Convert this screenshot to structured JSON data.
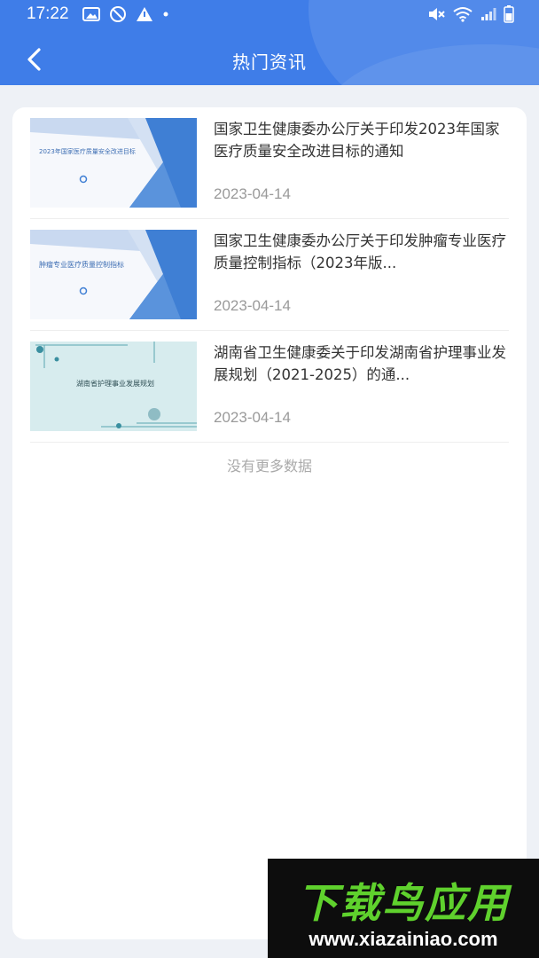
{
  "status_bar": {
    "time": "17:22"
  },
  "nav": {
    "title": "热门资讯"
  },
  "news": [
    {
      "thumb_caption": "2023年国家医疗质量安全改进目标",
      "title": "国家卫生健康委办公厅关于印发2023年国家医疗质量安全改进目标的通知",
      "date": "2023-04-14"
    },
    {
      "thumb_caption": "肿瘤专业医疗质量控制指标",
      "title": "国家卫生健康委办公厅关于印发肿瘤专业医疗质量控制指标（2023年版...",
      "date": "2023-04-14"
    },
    {
      "thumb_caption": "湖南省护理事业发展规划",
      "title": "湖南省卫生健康委关于印发湖南省护理事业发展规划（2021-2025）的通...",
      "date": "2023-04-14"
    }
  ],
  "footer": {
    "no_more": "没有更多数据"
  },
  "watermark": {
    "brand": "下载鸟应用",
    "url": "www.xiazainiao.com"
  },
  "colors": {
    "header_blue": "#3f7de8",
    "thumb_blue": "#3f7fd4",
    "watermark_green": "#5fd12d"
  }
}
